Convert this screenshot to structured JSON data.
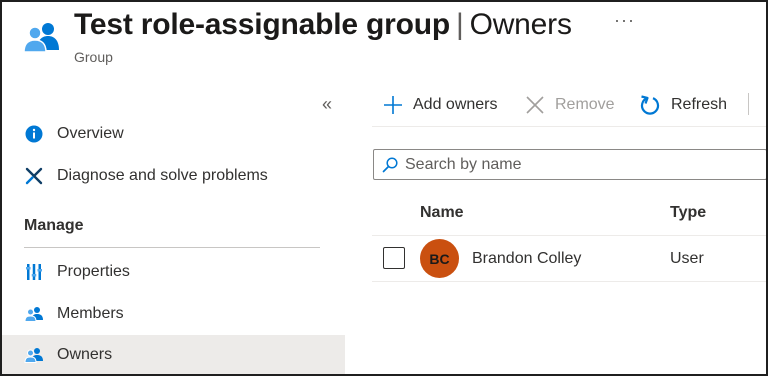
{
  "header": {
    "title": "Test role-assignable group",
    "separator": "|",
    "section": "Owners",
    "subtitle": "Group",
    "more_label": "···",
    "icon": "group-icon"
  },
  "sidebar": {
    "collapse_label": "«",
    "items_top": [
      {
        "label": "Overview",
        "icon": "info-icon"
      },
      {
        "label": "Diagnose and solve problems",
        "icon": "wrench-icon"
      }
    ],
    "section_title": "Manage",
    "items_manage": [
      {
        "label": "Properties",
        "icon": "properties-icon"
      },
      {
        "label": "Members",
        "icon": "members-icon"
      },
      {
        "label": "Owners",
        "icon": "owners-icon",
        "selected": true
      }
    ]
  },
  "toolbar": {
    "add_label": "Add owners",
    "remove_label": "Remove",
    "refresh_label": "Refresh"
  },
  "search": {
    "placeholder": "Search by name",
    "value": ""
  },
  "table": {
    "columns": [
      "Name",
      "Type"
    ],
    "rows": [
      {
        "initials": "BC",
        "name": "Brandon Colley",
        "type": "User",
        "avatar_color": "#ca5010"
      }
    ]
  },
  "colors": {
    "accent": "#0078d4",
    "selected_bg": "#edebe9"
  }
}
